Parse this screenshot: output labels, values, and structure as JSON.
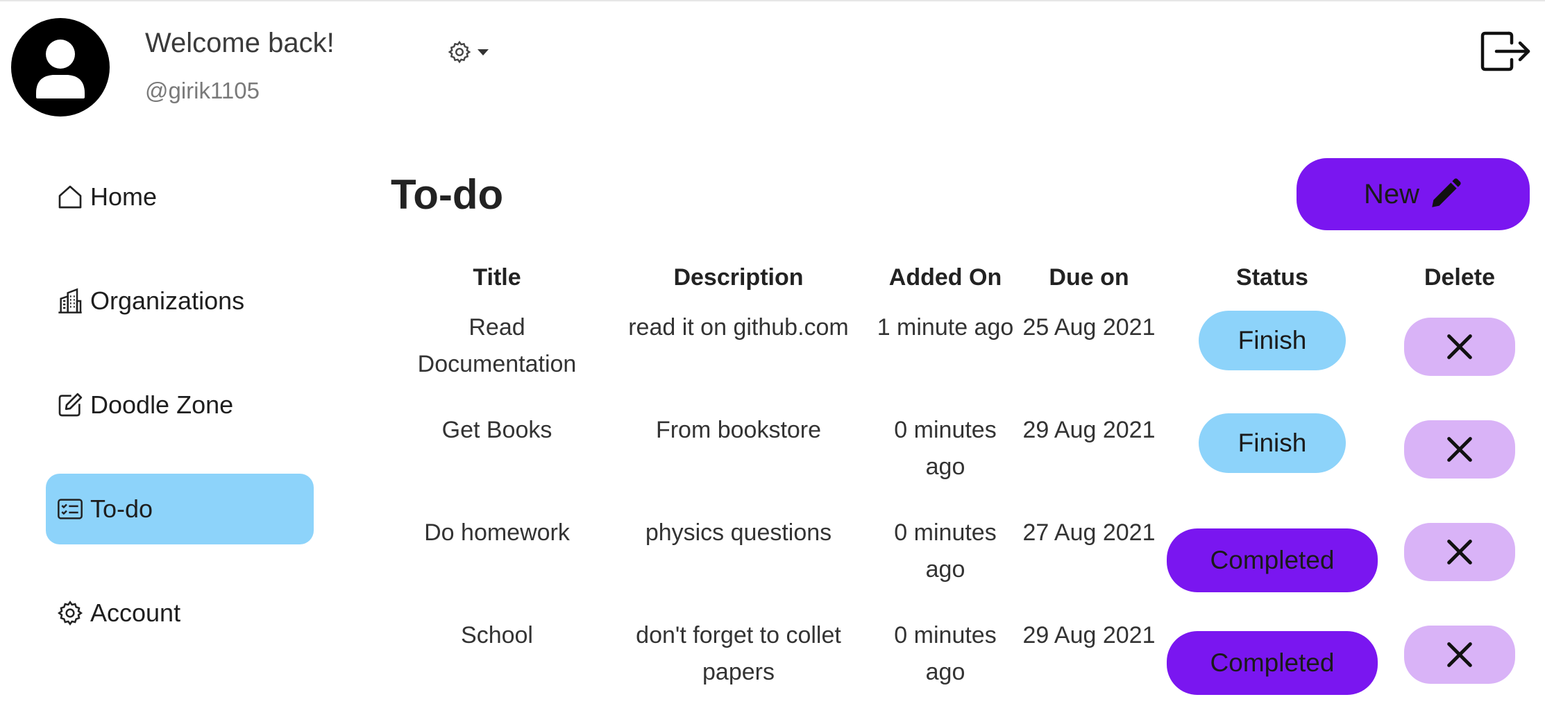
{
  "header": {
    "welcome": "Welcome back!",
    "username": "@girik1105",
    "avatar_icon": "user-avatar-icon",
    "settings_icon": "gear-icon",
    "logout_icon": "logout-icon"
  },
  "sidebar": {
    "items": [
      {
        "label": "Home",
        "icon": "home-icon",
        "active": false
      },
      {
        "label": "Organizations",
        "icon": "buildings-icon",
        "active": false
      },
      {
        "label": "Doodle Zone",
        "icon": "pencil-square-icon",
        "active": false
      },
      {
        "label": "To-do",
        "icon": "checklist-icon",
        "active": true
      },
      {
        "label": "Account",
        "icon": "gear-icon",
        "active": false
      }
    ]
  },
  "main": {
    "title": "To-do",
    "new_button_label": "New",
    "new_button_icon": "pencil-icon",
    "columns": [
      "Title",
      "Description",
      "Added On",
      "Due on",
      "Status",
      "Delete"
    ],
    "rows": [
      {
        "title": "Read Documentation",
        "description": "read it on github.com",
        "added_on": "1 minute ago",
        "due_on": "25 Aug 2021",
        "status": "Finish"
      },
      {
        "title": "Get Books",
        "description": "From bookstore",
        "added_on": "0 minutes ago",
        "due_on": "29 Aug 2021",
        "status": "Finish"
      },
      {
        "title": "Do homework",
        "description": "physics questions",
        "added_on": "0 minutes ago",
        "due_on": "27 Aug 2021",
        "status": "Completed"
      },
      {
        "title": "School",
        "description": "don't forget to collet papers",
        "added_on": "0 minutes ago",
        "due_on": "29 Aug 2021",
        "status": "Completed"
      }
    ],
    "delete_icon": "close-icon"
  },
  "colors": {
    "accent_purple": "#7a16f0",
    "accent_blue": "#8dd3fa",
    "delete_lavender": "#d9b3f7"
  }
}
